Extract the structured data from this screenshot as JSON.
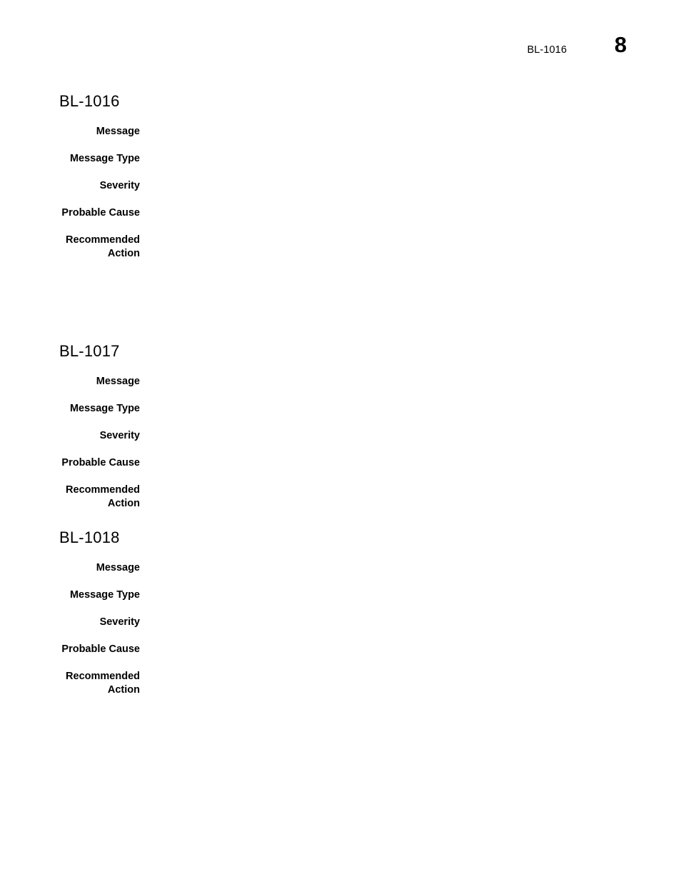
{
  "page": {
    "number": "8",
    "running_title": "BL-1016",
    "background_color": "#ffffff",
    "text_color": "#000000"
  },
  "sections": [
    {
      "id": "BL-1016",
      "title": "BL-1016",
      "fields": [
        {
          "label": "Message",
          "value": ""
        },
        {
          "label": "Message Type",
          "value": ""
        },
        {
          "label": "Severity",
          "value": ""
        },
        {
          "label": "Probable Cause",
          "value": ""
        },
        {
          "label": "Recommended\nAction",
          "value": ""
        }
      ]
    },
    {
      "id": "BL-1017",
      "title": "BL-1017",
      "fields": [
        {
          "label": "Message",
          "value": ""
        },
        {
          "label": "Message Type",
          "value": ""
        },
        {
          "label": "Severity",
          "value": ""
        },
        {
          "label": "Probable Cause",
          "value": ""
        },
        {
          "label": "Recommended\nAction",
          "value": ""
        }
      ]
    },
    {
      "id": "BL-1018",
      "title": "BL-1018",
      "fields": [
        {
          "label": "Message",
          "value": ""
        },
        {
          "label": "Message Type",
          "value": ""
        },
        {
          "label": "Severity",
          "value": ""
        },
        {
          "label": "Probable Cause",
          "value": ""
        },
        {
          "label": "Recommended\nAction",
          "value": ""
        }
      ]
    }
  ]
}
